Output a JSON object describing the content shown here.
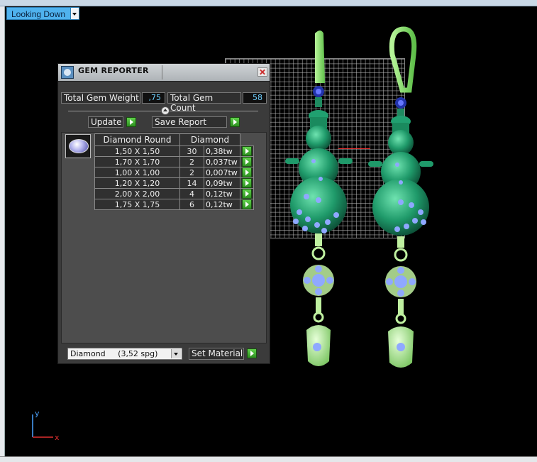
{
  "viewport": {
    "view_mode": "Looking Down"
  },
  "gem_reporter": {
    "title": "GEM REPORTER",
    "total_weight_label": "Total Gem Weight",
    "total_weight_value": ",75",
    "total_count_label": "Total Gem Count",
    "total_count_value": "58",
    "update_label": "Update",
    "save_report_label": "Save Report",
    "columns": [
      "Diamond Round",
      "Diamond"
    ],
    "rows": [
      {
        "size": "1,50 X 1,50",
        "count": "30",
        "weight": "0,38tw"
      },
      {
        "size": "1,70 X 1,70",
        "count": "2",
        "weight": "0,037tw"
      },
      {
        "size": "1,00 X 1,00",
        "count": "2",
        "weight": "0,007tw"
      },
      {
        "size": "1,20 X 1,20",
        "count": "14",
        "weight": "0,09tw"
      },
      {
        "size": "2,00 X 2,00",
        "count": "4",
        "weight": "0,12tw"
      },
      {
        "size": "1,75 X 1,75",
        "count": "6",
        "weight": "0,12tw"
      }
    ],
    "material_selected": "Diamond     (3,52 spg)",
    "set_material_label": "Set Material"
  },
  "axis": {
    "x_label": "x",
    "y_label": "y"
  },
  "colors": {
    "accent": "#4fb2ee",
    "go_button": "#3fb030",
    "jewelry": "#1f9a6a",
    "gem": "#8fa8ff"
  }
}
